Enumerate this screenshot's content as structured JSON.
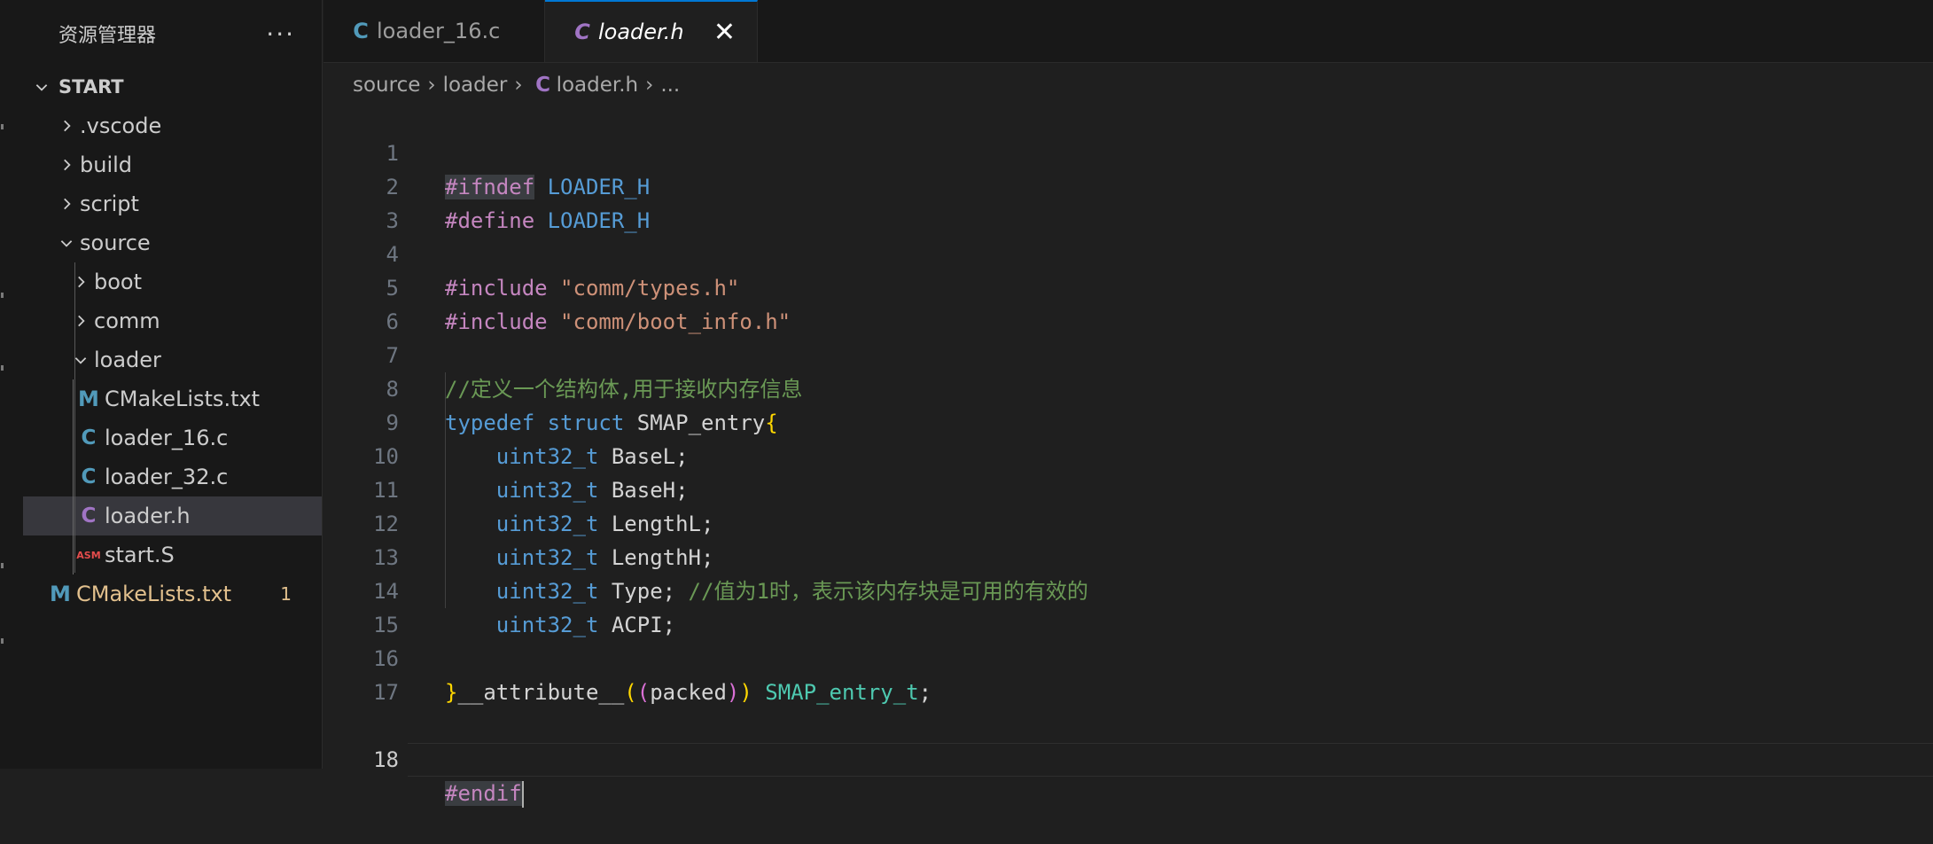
{
  "explorer": {
    "title": "资源管理器",
    "more_label": "···",
    "root": "START",
    "items": [
      {
        "label": ".vscode"
      },
      {
        "label": "build"
      },
      {
        "label": "script"
      },
      {
        "label": "source"
      },
      {
        "label": "boot"
      },
      {
        "label": "comm"
      },
      {
        "label": "loader"
      },
      {
        "label": "CMakeLists.txt"
      },
      {
        "label": "loader_16.c"
      },
      {
        "label": "loader_32.c"
      },
      {
        "label": "loader.h"
      },
      {
        "label": "start.S"
      },
      {
        "label": "CMakeLists.txt",
        "badge": "1"
      }
    ],
    "icons": {
      "c": "C",
      "h": "C",
      "m": "M",
      "asm": "ASM"
    }
  },
  "tabs": [
    {
      "label": "loader_16.c",
      "icon": "C",
      "active": false
    },
    {
      "label": "loader.h",
      "icon": "C",
      "active": true,
      "close": "✕"
    }
  ],
  "breadcrumb": {
    "parts": [
      "source",
      "loader",
      "loader.h",
      "..."
    ],
    "icon": "C"
  },
  "editor": {
    "line_numbers": [
      "1",
      "2",
      "3",
      "4",
      "5",
      "6",
      "7",
      "8",
      "9",
      "10",
      "11",
      "12",
      "13",
      "14",
      "15",
      "16",
      "17",
      "18"
    ],
    "current_line": "18",
    "code": {
      "l1": {
        "pp": "#ifndef",
        "macro": "LOADER_H"
      },
      "l2": {
        "pp": "#define",
        "macro": "LOADER_H"
      },
      "l4": {
        "pp": "#include",
        "str": "\"comm/types.h\""
      },
      "l5": {
        "pp": "#include",
        "str": "\"comm/boot_info.h\""
      },
      "l7": {
        "comment": "//定义一个结构体,用于接收内存信息"
      },
      "l8": {
        "kw1": "typedef",
        "kw2": "struct",
        "name": "SMAP_entry",
        "brace": "{"
      },
      "l9": {
        "type": "uint32_t",
        "field": "BaseL;"
      },
      "l10": {
        "type": "uint32_t",
        "field": "BaseH;"
      },
      "l11": {
        "type": "uint32_t",
        "field": "LengthL;"
      },
      "l12": {
        "type": "uint32_t",
        "field": "LengthH;"
      },
      "l13": {
        "type": "uint32_t",
        "field": "Type;",
        "comment": "//值为1时，表示该内存块是可用的有效的"
      },
      "l14": {
        "type": "uint32_t",
        "field": "ACPI;"
      },
      "l16": {
        "brace": "}",
        "attr": "__attribute__",
        "p1": "(",
        "p2": "(",
        "arg": "packed",
        "p3": ")",
        "p4": ")",
        "tname": "SMAP_entry_t",
        "semi": ";"
      },
      "l18": {
        "pp": "#endif"
      }
    }
  },
  "colors": {
    "accent": "#0078d4",
    "preprocessor": "#c586c0",
    "keyword": "#569cd6",
    "type": "#4ec9b0",
    "string": "#ce9178",
    "comment": "#6a9955",
    "modified": "#e2c08d"
  }
}
